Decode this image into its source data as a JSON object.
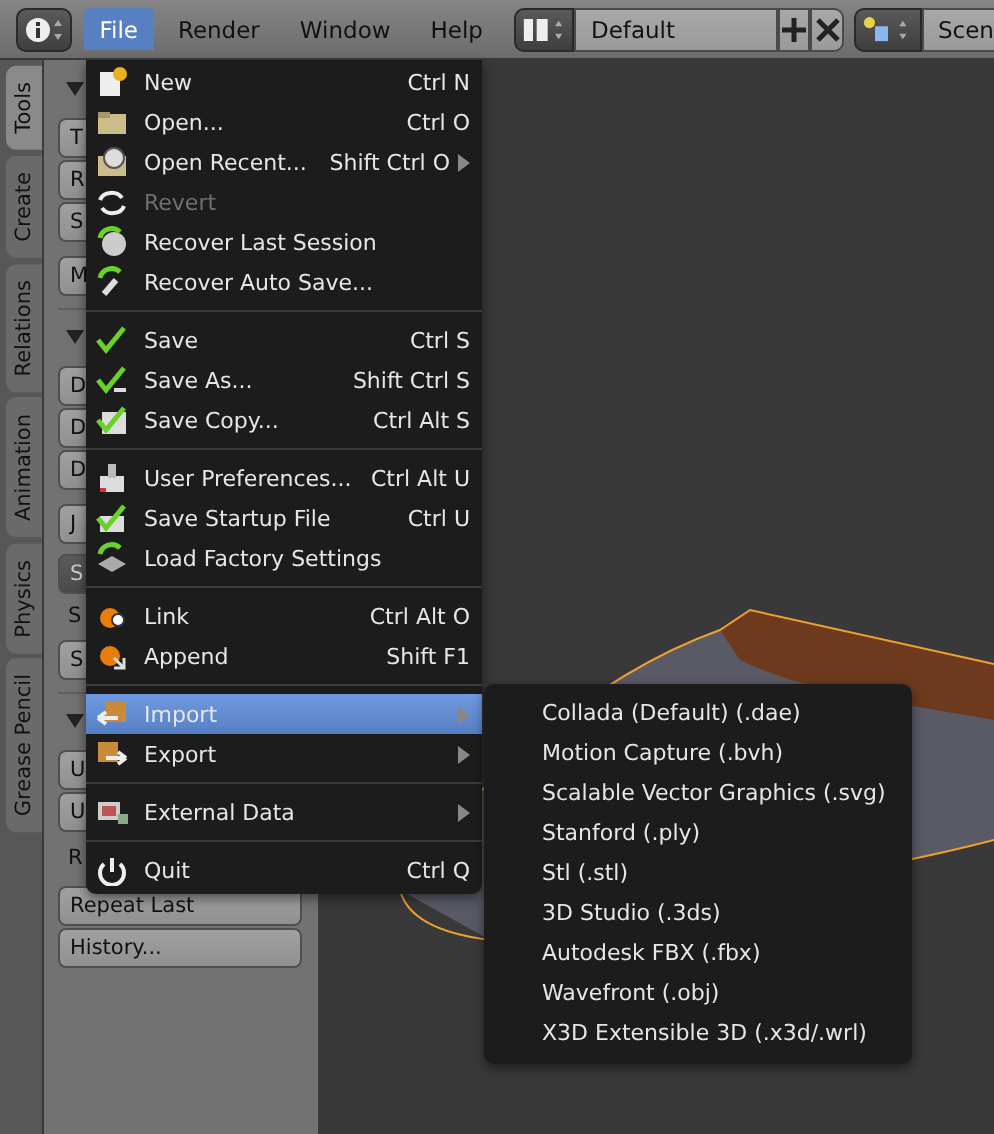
{
  "header": {
    "menus": [
      {
        "label": "File",
        "selected": true
      },
      {
        "label": "Render",
        "selected": false
      },
      {
        "label": "Window",
        "selected": false
      },
      {
        "label": "Help",
        "selected": false
      }
    ],
    "layout": "Default",
    "scene": "Scen"
  },
  "tabs": [
    {
      "label": "Tools",
      "selected": true
    },
    {
      "label": "Create",
      "selected": false
    },
    {
      "label": "Relations",
      "selected": false
    },
    {
      "label": "Animation",
      "selected": false
    },
    {
      "label": "Physics",
      "selected": false
    },
    {
      "label": "Grease Pencil",
      "selected": false
    }
  ],
  "panel": [
    {
      "kind": "header",
      "expanded": true
    },
    {
      "kind": "button",
      "label": "T"
    },
    {
      "kind": "button",
      "label": "R"
    },
    {
      "kind": "button",
      "label": "S"
    },
    {
      "kind": "gap"
    },
    {
      "kind": "button",
      "label": "M"
    },
    {
      "kind": "header",
      "expanded": true
    },
    {
      "kind": "button",
      "label": "D"
    },
    {
      "kind": "button",
      "label": "D"
    },
    {
      "kind": "button",
      "label": "D"
    },
    {
      "kind": "gap"
    },
    {
      "kind": "button",
      "label": "J"
    },
    {
      "kind": "dropdown",
      "label": "S"
    },
    {
      "kind": "label",
      "label": "S"
    },
    {
      "kind": "button",
      "label": "S"
    },
    {
      "kind": "header",
      "expanded": true
    },
    {
      "kind": "button",
      "label": "U"
    },
    {
      "kind": "button",
      "label": "U"
    },
    {
      "kind": "label",
      "label": "R"
    },
    {
      "kind": "button",
      "label": "Repeat Last"
    },
    {
      "kind": "button",
      "label": "History..."
    }
  ],
  "file_menu": [
    {
      "kind": "item",
      "label": "New",
      "shortcut": "Ctrl N",
      "submenu": false,
      "disabled": false,
      "selected": false
    },
    {
      "kind": "item",
      "label": "Open...",
      "shortcut": "Ctrl O",
      "submenu": false,
      "disabled": false,
      "selected": false
    },
    {
      "kind": "item",
      "label": "Open Recent...",
      "shortcut": "Shift Ctrl O",
      "submenu": true,
      "disabled": false,
      "selected": false
    },
    {
      "kind": "item",
      "label": "Revert",
      "submenu": false,
      "disabled": true,
      "selected": false
    },
    {
      "kind": "item",
      "label": "Recover Last Session",
      "submenu": false,
      "disabled": false,
      "selected": false
    },
    {
      "kind": "item",
      "label": "Recover Auto Save...",
      "submenu": false,
      "disabled": false,
      "selected": false
    },
    {
      "kind": "separator"
    },
    {
      "kind": "item",
      "label": "Save",
      "shortcut": "Ctrl S",
      "submenu": false,
      "disabled": false,
      "selected": false
    },
    {
      "kind": "item",
      "label": "Save As...",
      "shortcut": "Shift Ctrl S",
      "submenu": false,
      "disabled": false,
      "selected": false
    },
    {
      "kind": "item",
      "label": "Save Copy...",
      "shortcut": "Ctrl Alt S",
      "submenu": false,
      "disabled": false,
      "selected": false
    },
    {
      "kind": "separator"
    },
    {
      "kind": "item",
      "label": "User Preferences...",
      "shortcut": "Ctrl Alt U",
      "submenu": false,
      "disabled": false,
      "selected": false
    },
    {
      "kind": "item",
      "label": "Save Startup File",
      "shortcut": "Ctrl U",
      "submenu": false,
      "disabled": false,
      "selected": false
    },
    {
      "kind": "item",
      "label": "Load Factory Settings",
      "submenu": false,
      "disabled": false,
      "selected": false
    },
    {
      "kind": "separator"
    },
    {
      "kind": "item",
      "label": "Link",
      "shortcut": "Ctrl Alt O",
      "submenu": false,
      "disabled": false,
      "selected": false
    },
    {
      "kind": "item",
      "label": "Append",
      "shortcut": "Shift F1",
      "submenu": false,
      "disabled": false,
      "selected": false
    },
    {
      "kind": "separator"
    },
    {
      "kind": "item",
      "label": "Import",
      "submenu": true,
      "disabled": false,
      "selected": true
    },
    {
      "kind": "item",
      "label": "Export",
      "submenu": true,
      "disabled": false,
      "selected": false
    },
    {
      "kind": "separator"
    },
    {
      "kind": "item",
      "label": "External Data",
      "submenu": true,
      "disabled": false,
      "selected": false
    },
    {
      "kind": "separator"
    },
    {
      "kind": "item",
      "label": "Quit",
      "shortcut": "Ctrl Q",
      "submenu": false,
      "disabled": false,
      "selected": false
    }
  ],
  "import_menu": [
    "Collada (Default) (.dae)",
    "Motion Capture (.bvh)",
    "Scalable Vector Graphics (.svg)",
    "Stanford (.ply)",
    "Stl (.stl)",
    "3D Studio (.3ds)",
    "Autodesk FBX (.fbx)",
    "Wavefront (.obj)",
    "X3D Extensible 3D (.x3d/.wrl)"
  ]
}
